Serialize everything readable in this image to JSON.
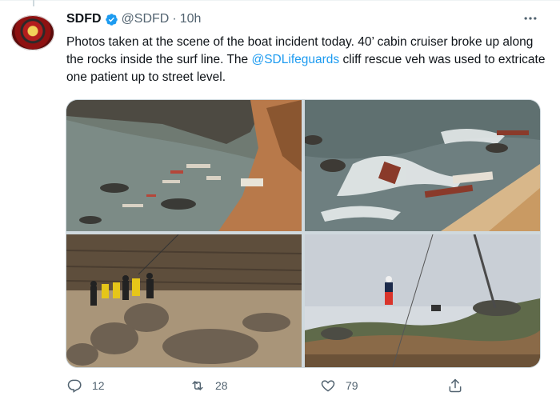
{
  "tweet": {
    "display_name": "SDFD",
    "verified": true,
    "handle": "@SDFD",
    "separator": "·",
    "time": "10h",
    "more_icon": "more-horizontal-icon",
    "text_before": "Photos taken at the scene of the boat incident today. 40’ cabin cruiser broke up along the rocks inside the surf line. The ",
    "mention": "@SDLifeguards",
    "text_after": " cliff rescue veh was used to extricate one patient up to street level."
  },
  "media": {
    "photos": [
      {
        "icon": "boat-wreckage-photo"
      },
      {
        "icon": "boat-debris-surf-photo"
      },
      {
        "icon": "rescuers-on-rocks-photo"
      },
      {
        "icon": "cliff-rescue-crane-photo"
      }
    ]
  },
  "actions": {
    "reply_count": "12",
    "retweet_count": "28",
    "like_count": "79",
    "share_icon": "share-icon"
  },
  "colors": {
    "accent": "#1d9bf0",
    "text": "#0f1419",
    "muted": "#536471"
  }
}
